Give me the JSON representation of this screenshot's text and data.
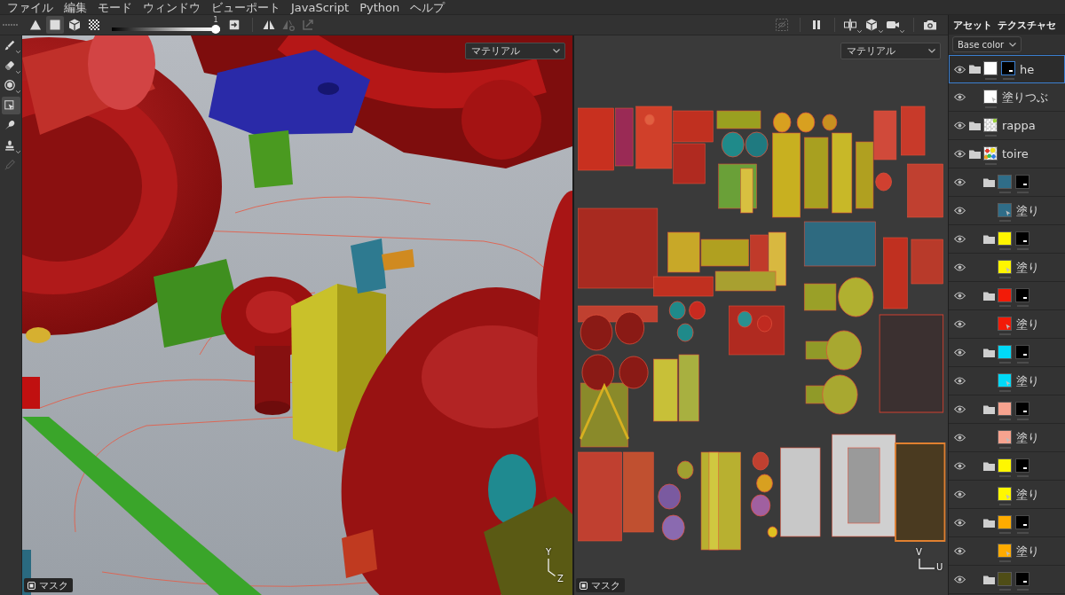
{
  "menu": [
    "ファイル",
    "編集",
    "モード",
    "ウィンドウ",
    "ビューポート",
    "JavaScript",
    "Python",
    "ヘルプ"
  ],
  "toolbar": {
    "selection_modes": [
      {
        "selected": false
      },
      {
        "selected": true
      },
      {
        "selected": false
      },
      {
        "selected": false
      }
    ],
    "slider": {
      "value": "1",
      "level": 1
    },
    "symmetry": [
      {
        "disabled": false
      },
      {
        "disabled": true
      },
      {
        "disabled": true
      }
    ],
    "view_controls": [
      {
        "disabled": true,
        "has_menu": false
      },
      {
        "disabled": false,
        "has_menu": false
      },
      {
        "disabled": false,
        "has_menu": true
      },
      {
        "disabled": false,
        "has_menu": true
      },
      {
        "disabled": false,
        "has_menu": true
      },
      {
        "disabled": false,
        "has_menu": false
      }
    ]
  },
  "tools": [
    {
      "selected": false,
      "disabled": false,
      "has_menu": true
    },
    {
      "selected": false,
      "disabled": false,
      "has_menu": true
    },
    {
      "selected": false,
      "disabled": false,
      "has_menu": true
    },
    {
      "selected": true,
      "disabled": false,
      "has_menu": false
    },
    {
      "selected": false,
      "disabled": false,
      "has_menu": false
    },
    {
      "selected": false,
      "disabled": false,
      "has_menu": true
    },
    {
      "selected": false,
      "disabled": true,
      "has_menu": false
    }
  ],
  "viewports": [
    {
      "kind": "model",
      "dropdown": "マテリアル",
      "mask_label": "マスク",
      "axes": [
        "Y",
        "Z"
      ]
    },
    {
      "kind": "uv",
      "dropdown": "マテリアル",
      "mask_label": "マスク",
      "axes": [
        "V",
        "U"
      ]
    }
  ],
  "panel": {
    "tabs": [
      {
        "label": "アセット",
        "selected": true
      },
      {
        "label": "テクスチャセ",
        "selected": true
      }
    ],
    "channel": "Base color",
    "layers": [
      {
        "name": "he",
        "kind": "folder",
        "thumbnail": {
          "kind": "solid",
          "color": "#ffffff"
        },
        "mask": true,
        "selected": true,
        "children": [
          {
            "name": "塗りつぶ",
            "kind": "fill",
            "thumbnail": {
              "kind": "solid",
              "color": "#ffffff"
            },
            "mask": false,
            "selected": false
          }
        ]
      },
      {
        "name": "rappa",
        "kind": "folder",
        "thumbnail": {
          "kind": "checker"
        },
        "mask": false,
        "selected": false
      },
      {
        "name": "toire",
        "kind": "folder",
        "thumbnail": {
          "kind": "checker-dots"
        },
        "mask": false,
        "selected": false,
        "children": [
          {
            "kind": "folder",
            "thumbnail": {
              "kind": "solid",
              "color": "#2f6d88"
            },
            "mask": true,
            "selected": false,
            "children": [
              {
                "name": "塗り",
                "kind": "fill",
                "thumbnail": {
                  "kind": "solid",
                  "color": "#2f6d88"
                },
                "mask": false,
                "selected": false
              }
            ]
          },
          {
            "kind": "folder",
            "thumbnail": {
              "kind": "solid",
              "color": "#fff500"
            },
            "mask": true,
            "selected": false,
            "children": [
              {
                "name": "塗り",
                "kind": "fill",
                "thumbnail": {
                  "kind": "solid",
                  "color": "#fff500"
                },
                "mask": false,
                "selected": false
              }
            ]
          },
          {
            "kind": "folder",
            "thumbnail": {
              "kind": "solid",
              "color": "#f21b08"
            },
            "mask": true,
            "selected": false,
            "children": [
              {
                "name": "塗り",
                "kind": "fill",
                "thumbnail": {
                  "kind": "solid",
                  "color": "#f21b08"
                },
                "mask": false,
                "selected": false
              }
            ]
          },
          {
            "kind": "folder",
            "thumbnail": {
              "kind": "solid",
              "color": "#00d9f7"
            },
            "mask": true,
            "selected": false,
            "children": [
              {
                "name": "塗り",
                "kind": "fill",
                "thumbnail": {
                  "kind": "solid",
                  "color": "#00d9f7"
                },
                "mask": false,
                "selected": false
              }
            ]
          },
          {
            "kind": "folder",
            "thumbnail": {
              "kind": "solid",
              "color": "#f7a38f"
            },
            "mask": true,
            "selected": false,
            "children": [
              {
                "name": "塗り",
                "kind": "fill",
                "thumbnail": {
                  "kind": "solid",
                  "color": "#f7a38f"
                },
                "mask": false,
                "selected": false
              }
            ]
          },
          {
            "kind": "folder",
            "thumbnail": {
              "kind": "solid",
              "color": "#fff700"
            },
            "mask": true,
            "selected": false,
            "children": [
              {
                "name": "塗り",
                "kind": "fill",
                "thumbnail": {
                  "kind": "solid",
                  "color": "#fff700"
                },
                "mask": false,
                "selected": false
              }
            ]
          },
          {
            "kind": "folder",
            "thumbnail": {
              "kind": "solid",
              "color": "#ffab00"
            },
            "mask": true,
            "selected": false,
            "children": [
              {
                "name": "塗り",
                "kind": "fill",
                "thumbnail": {
                  "kind": "solid",
                  "color": "#ffab00"
                },
                "mask": false,
                "selected": false
              }
            ]
          },
          {
            "kind": "folder",
            "thumbnail": {
              "kind": "solid",
              "color": "#4f4d16"
            },
            "mask": true,
            "selected": false
          }
        ]
      }
    ]
  }
}
